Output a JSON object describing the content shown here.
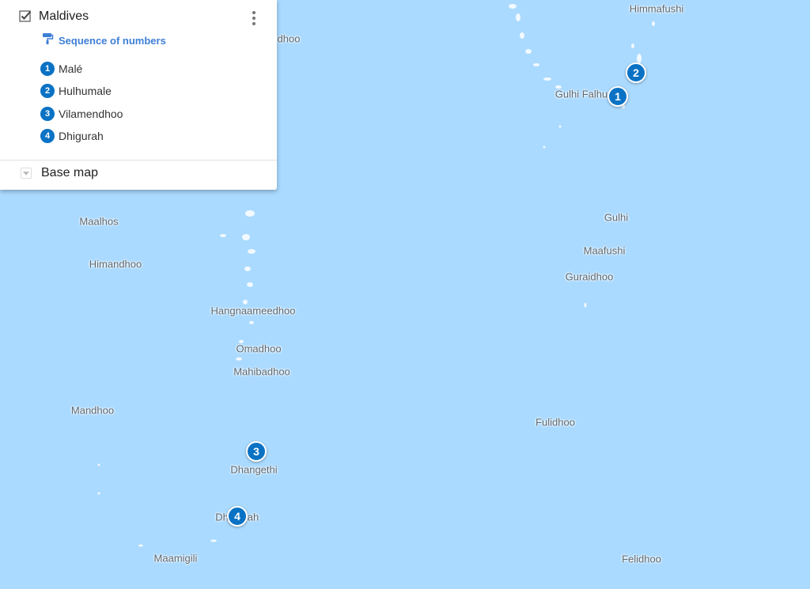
{
  "panel": {
    "layer_name": "Maldives",
    "style_label": "Sequence of numbers",
    "locations": [
      {
        "number": "1",
        "name": "Malé"
      },
      {
        "number": "2",
        "name": "Hulhumale"
      },
      {
        "number": "3",
        "name": "Vilamendhoo"
      },
      {
        "number": "4",
        "name": "Dhigurah"
      }
    ],
    "basemap_label": "Base map"
  },
  "map": {
    "places": {
      "himmafushi": "Himmafushi",
      "dhoo_partial": "dhoo",
      "gulhi_falhu": "Gulhi Falhu",
      "gulhi": "Gulhi",
      "maafushi": "Maafushi",
      "guraidhoo": "Guraidhoo",
      "maalhos": "Maalhos",
      "himandhoo": "Himandhoo",
      "hangnaameedhoo": "Hangnaameedhoo",
      "omadhoo": "Omadhoo",
      "mahibadhoo": "Mahibadhoo",
      "mandhoo": "Mandhoo",
      "fulidhoo": "Fulidhoo",
      "dhangethi": "Dhangethi",
      "dhigurah_partial": "Dhi",
      "dhigurah_partial_end": "ah",
      "maamigili": "Maamigili",
      "felidhoo": "Felidhoo"
    },
    "markers": [
      "1",
      "2",
      "3",
      "4"
    ]
  },
  "colors": {
    "water": "#aadaff",
    "marker": "#0a72c4",
    "style_label": "#3e7fd6",
    "land": "#ffffff"
  },
  "icons": {
    "checkbox": "checkbox-checked-icon",
    "style": "paint-roller-icon",
    "menu": "more-vert-icon",
    "basemap": "chevron-down-icon"
  }
}
